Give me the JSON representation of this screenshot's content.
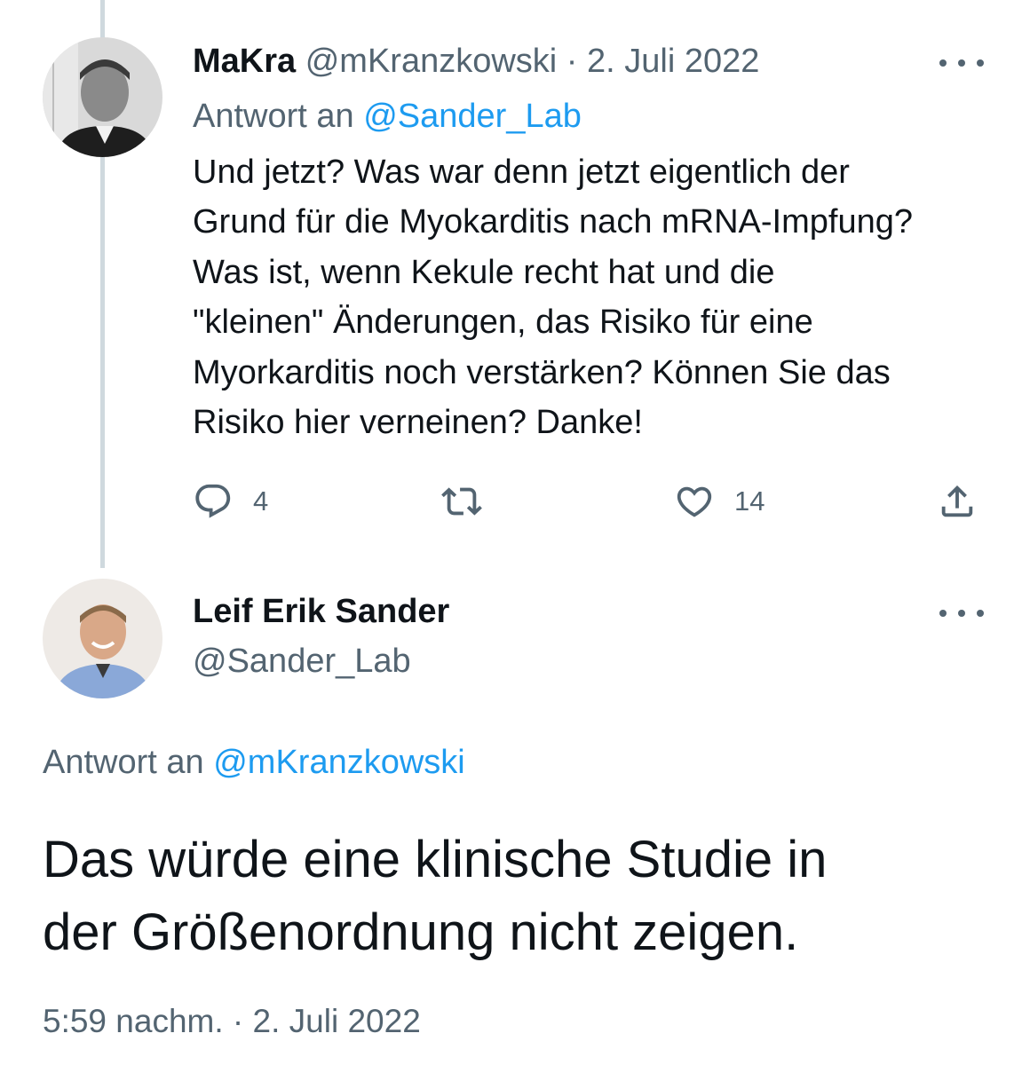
{
  "tweet1": {
    "display_name": "MaKra",
    "handle": "@mKranzkowski",
    "separator": "·",
    "date": "2. Juli 2022",
    "reply_prefix": "Antwort an",
    "reply_to": "@Sander_Lab",
    "text": "Und jetzt? Was war denn jetzt eigentlich der\nGrund für die Myokarditis nach mRNA-Impfung?\nWas ist, wenn Kekule recht hat und die\n\"kleinen\" Änderungen, das Risiko für eine\nMyorkarditis noch verstärken? Können Sie das\nRisiko hier verneinen? Danke!",
    "replies": "4",
    "likes": "14",
    "icons": {
      "reply": "reply-icon",
      "retweet": "retweet-icon",
      "like": "heart-icon",
      "share": "share-icon",
      "more": "more-icon"
    }
  },
  "tweet2": {
    "display_name": "Leif Erik Sander",
    "handle": "@Sander_Lab",
    "reply_prefix": "Antwort an",
    "reply_to": "@mKranzkowski",
    "text": "Das würde eine klinische Studie in\nder Größenordnung nicht zeigen.",
    "time": "5:59 nachm.",
    "separator": "·",
    "date": "2. Juli 2022"
  },
  "colors": {
    "text": "#0f1419",
    "muted": "#536471",
    "link": "#1d9bf0",
    "thread_line": "#cfd9de"
  }
}
